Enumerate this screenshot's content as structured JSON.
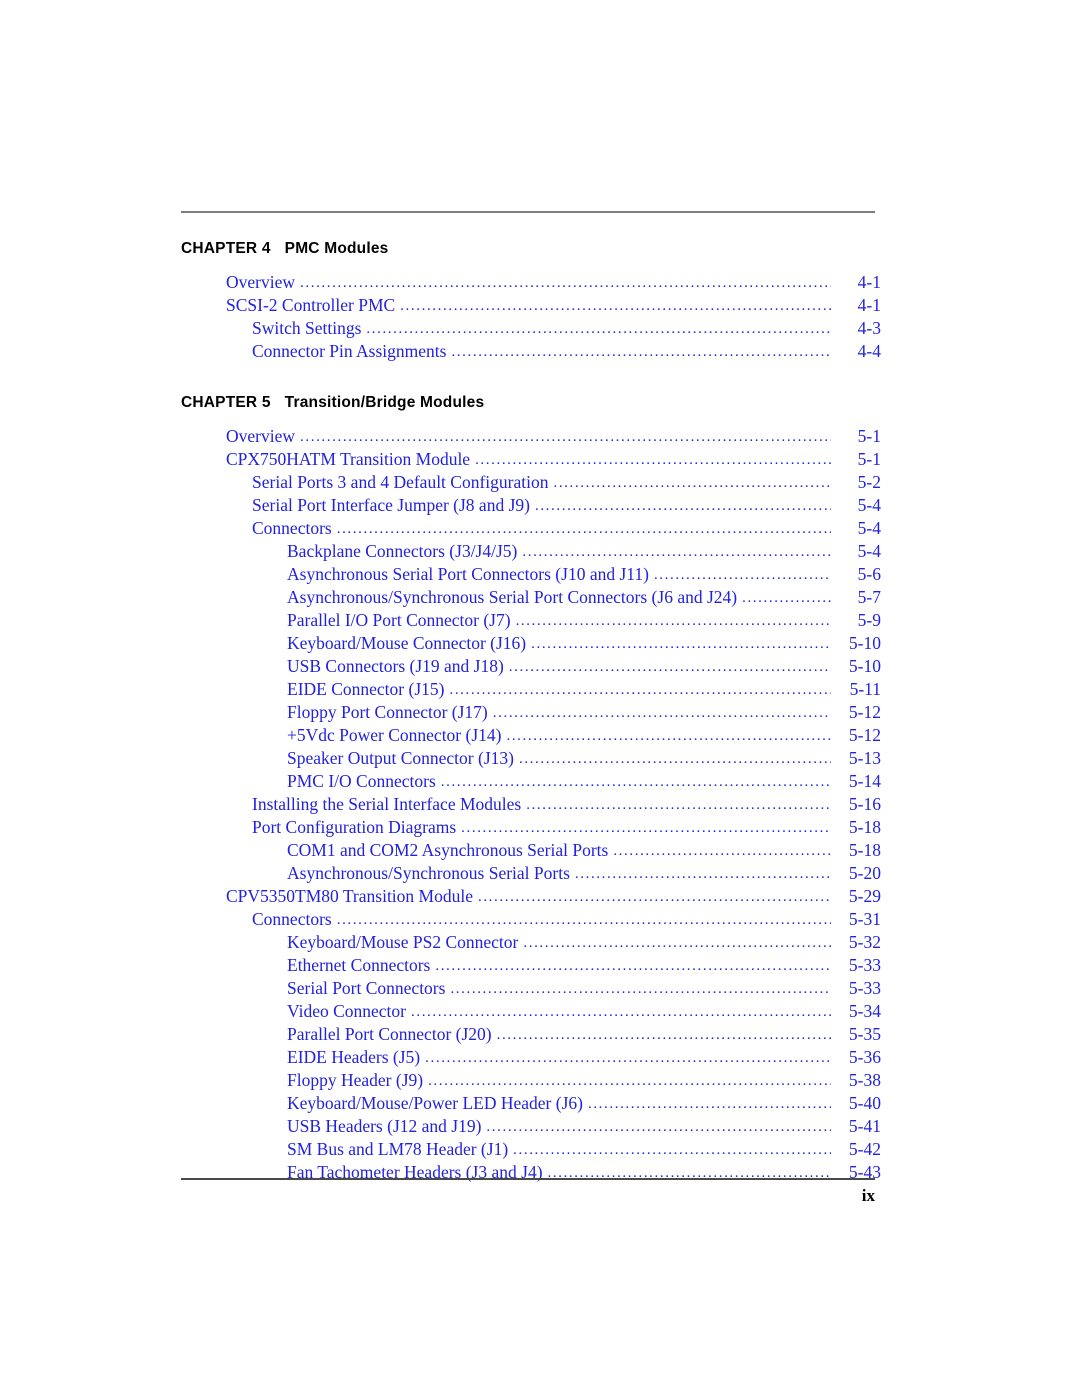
{
  "document": {
    "folio": "ix"
  },
  "sections": [
    {
      "chapter_label": "CHAPTER 4",
      "chapter_title": "PMC Modules",
      "entries": [
        {
          "level": 1,
          "label": "Overview",
          "page": "4-1"
        },
        {
          "level": 1,
          "label": "SCSI-2 Controller PMC",
          "page": "4-1"
        },
        {
          "level": 2,
          "label": "Switch Settings",
          "page": "4-3"
        },
        {
          "level": 2,
          "label": "Connector Pin Assignments",
          "page": "4-4"
        }
      ]
    },
    {
      "chapter_label": "CHAPTER 5",
      "chapter_title": "Transition/Bridge Modules",
      "entries": [
        {
          "level": 1,
          "label": "Overview",
          "page": "5-1"
        },
        {
          "level": 1,
          "label": "CPX750HATM Transition Module",
          "page": "5-1"
        },
        {
          "level": 2,
          "label": "Serial Ports 3 and 4 Default Configuration",
          "page": "5-2"
        },
        {
          "level": 2,
          "label": "Serial Port Interface Jumper (J8 and J9)",
          "page": "5-4"
        },
        {
          "level": 2,
          "label": "Connectors",
          "page": "5-4"
        },
        {
          "level": 3,
          "label": "Backplane Connectors (J3/J4/J5)",
          "page": "5-4"
        },
        {
          "level": 3,
          "label": "Asynchronous Serial Port Connectors (J10 and J11)",
          "page": "5-6"
        },
        {
          "level": 3,
          "label": "Asynchronous/Synchronous Serial Port Connectors (J6 and J24)",
          "page": "5-7"
        },
        {
          "level": 3,
          "label": "Parallel I/O Port Connector (J7)",
          "page": "5-9"
        },
        {
          "level": 3,
          "label": "Keyboard/Mouse Connector (J16)",
          "page": "5-10"
        },
        {
          "level": 3,
          "label": "USB Connectors (J19 and J18)",
          "page": "5-10"
        },
        {
          "level": 3,
          "label": "EIDE Connector (J15)",
          "page": "5-11"
        },
        {
          "level": 3,
          "label": "Floppy Port Connector (J17)",
          "page": "5-12"
        },
        {
          "level": 3,
          "label": "+5Vdc Power Connector (J14)",
          "page": "5-12"
        },
        {
          "level": 3,
          "label": "Speaker Output Connector (J13)",
          "page": "5-13"
        },
        {
          "level": 3,
          "label": "PMC I/O Connectors",
          "page": "5-14"
        },
        {
          "level": 2,
          "label": "Installing the Serial Interface Modules",
          "page": "5-16"
        },
        {
          "level": 2,
          "label": "Port Configuration Diagrams",
          "page": "5-18"
        },
        {
          "level": 3,
          "label": "COM1 and COM2 Asynchronous Serial Ports",
          "page": "5-18"
        },
        {
          "level": 3,
          "label": "Asynchronous/Synchronous Serial Ports",
          "page": "5-20"
        },
        {
          "level": 1,
          "label": "CPV5350TM80 Transition Module",
          "page": "5-29"
        },
        {
          "level": 2,
          "label": "Connectors",
          "page": "5-31"
        },
        {
          "level": 3,
          "label": "Keyboard/Mouse PS2 Connector",
          "page": "5-32"
        },
        {
          "level": 3,
          "label": "Ethernet Connectors",
          "page": "5-33"
        },
        {
          "level": 3,
          "label": "Serial Port Connectors",
          "page": "5-33"
        },
        {
          "level": 3,
          "label": "Video Connector",
          "page": "5-34"
        },
        {
          "level": 3,
          "label": "Parallel Port Connector (J20)",
          "page": "5-35"
        },
        {
          "level": 3,
          "label": "EIDE Headers (J5)",
          "page": "5-36"
        },
        {
          "level": 3,
          "label": "Floppy Header (J9)",
          "page": "5-38"
        },
        {
          "level": 3,
          "label": "Keyboard/Mouse/Power LED Header (J6)",
          "page": "5-40"
        },
        {
          "level": 3,
          "label": "USB Headers (J12 and J19)",
          "page": "5-41"
        },
        {
          "level": 3,
          "label": "SM Bus and LM78 Header (J1)",
          "page": "5-42"
        },
        {
          "level": 3,
          "label": "Fan Tachometer Headers (J3 and J4)",
          "page": "5-43"
        }
      ]
    }
  ],
  "colors": {
    "link_blue": "#2222dd",
    "rule_gray": "#808080",
    "text_black": "#000000"
  }
}
